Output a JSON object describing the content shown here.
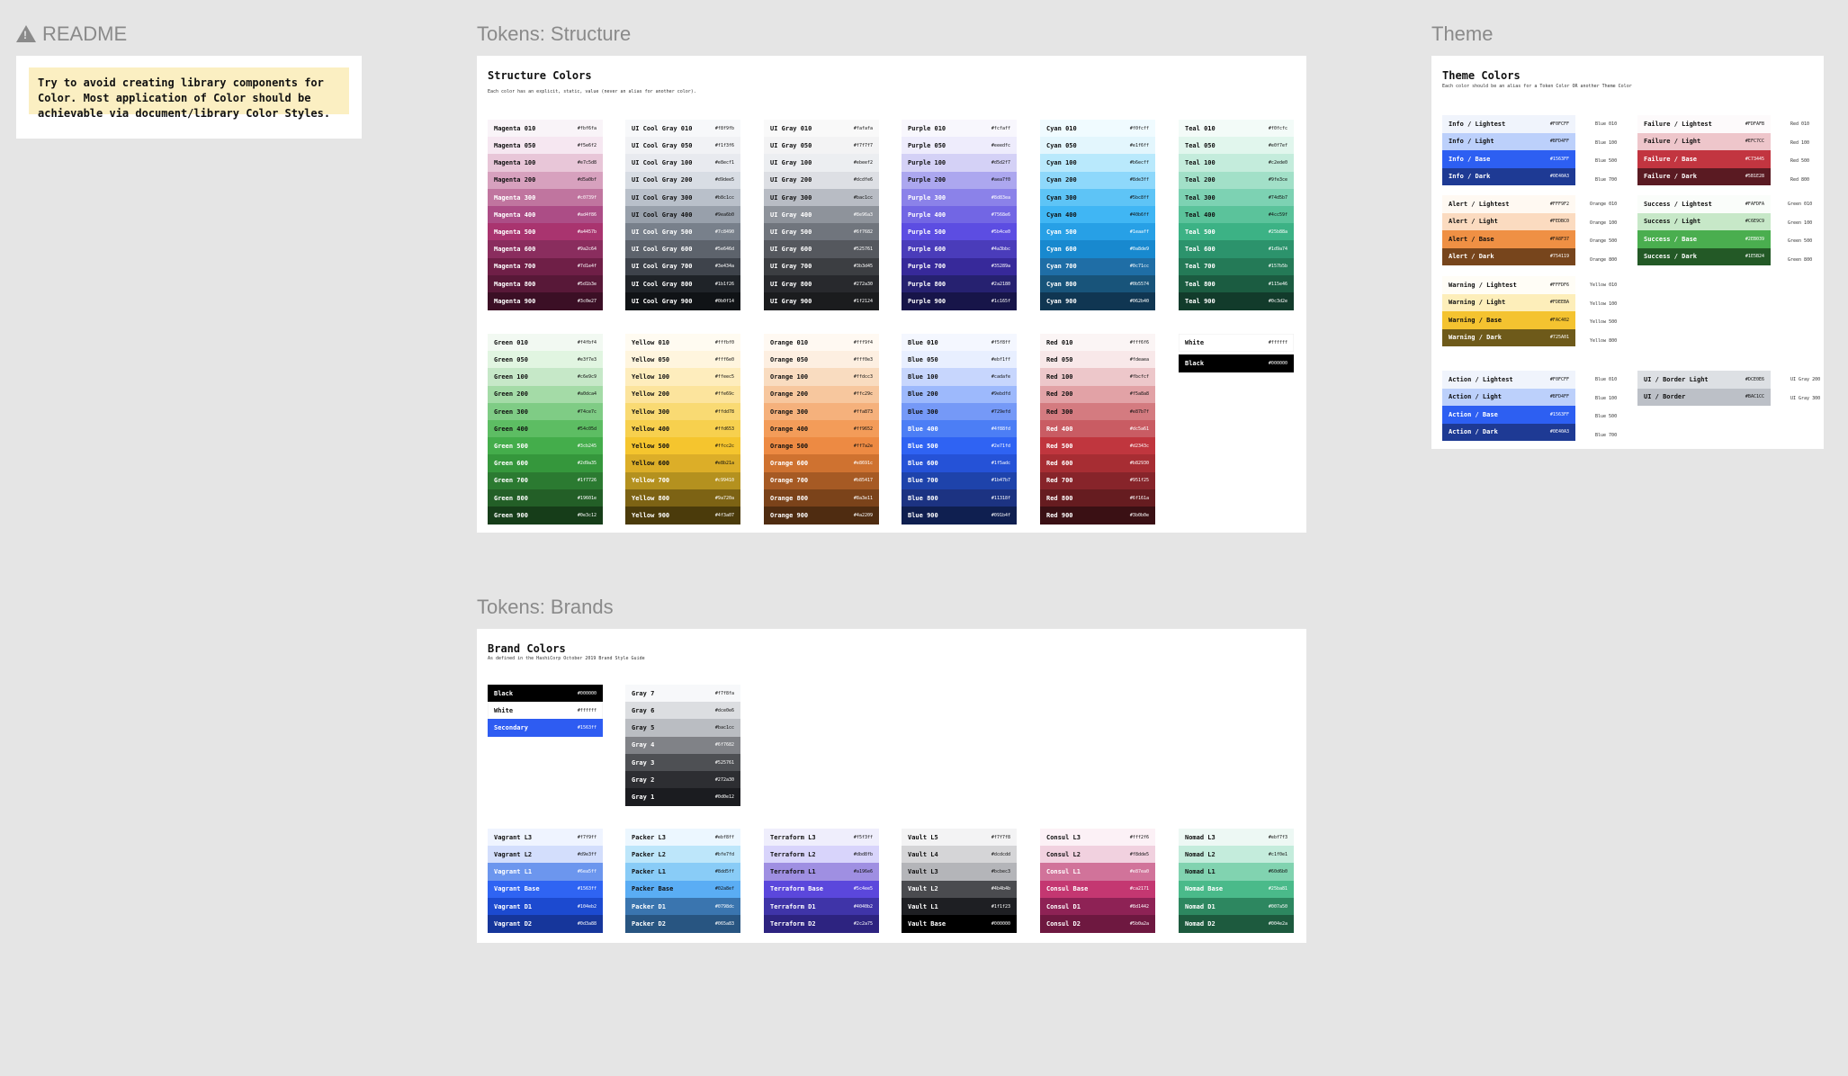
{
  "readme": {
    "title": "README",
    "note": "Try to avoid creating library components for Color. Most application of Color should be achievable via document/library Color Styles."
  },
  "structure": {
    "frame_title": "Tokens: Structure",
    "title": "Structure Colors",
    "subtitle": "Each color has an explicit, static, value (never an alias for another color).",
    "columns": [
      [
        [
          "Magenta 010",
          "#fbf6fa",
          "#f9f4f8"
        ],
        [
          "Magenta 050",
          "#f5e6f2",
          "#f6e7f1"
        ],
        [
          "Magenta 100",
          "#e7c5d8",
          "#e8c6d8"
        ],
        [
          "Magenta 200",
          "#d5a0bf",
          "#d7a1be"
        ],
        [
          "Magenta 300",
          "#c0739f",
          "#c0759f"
        ],
        [
          "Magenta 400",
          "#ad4f86",
          "#ac4d86"
        ],
        [
          "Magenta 500",
          "#a4457b",
          "#a9346f"
        ],
        [
          "Magenta 600",
          "#9a2c64",
          "#8a2d5e"
        ],
        [
          "Magenta 700",
          "#7d1e4f",
          "#6f1f47"
        ],
        [
          "Magenta 800",
          "#5d1b3e",
          "#581838"
        ],
        [
          "Magenta 900",
          "#3c0e27",
          "#3b0f25"
        ]
      ],
      [
        [
          "UI Cool Gray 010",
          "#f8f9fb",
          "#f7f8fa"
        ],
        [
          "UI Cool Gray 050",
          "#f1f3f6",
          "#f1f2f5"
        ],
        [
          "UI Cool Gray 100",
          "#e8ecf1",
          "#e8eaef"
        ],
        [
          "UI Cool Gray 200",
          "#d9dee5",
          "#d8dde4"
        ],
        [
          "UI Cool Gray 300",
          "#b8c1cc",
          "#b9c0ca"
        ],
        [
          "UI Cool Gray 400",
          "#9ea6b0",
          "#98a0ab"
        ],
        [
          "UI Cool Gray 500",
          "#7c8490",
          "#78808b"
        ],
        [
          "UI Cool Gray 600",
          "#5e646d",
          "#5d636c"
        ],
        [
          "UI Cool Gray 700",
          "#3e434a",
          "#3e434b"
        ],
        [
          "UI Cool Gray 800",
          "#1b1f26",
          "#1f2328"
        ],
        [
          "UI Cool Gray 900",
          "#0b0f14",
          "#101316"
        ]
      ],
      [
        [
          "UI Gray 010",
          "#fafafa",
          "#f9f9f9"
        ],
        [
          "UI Gray 050",
          "#f7f7f7",
          "#f3f3f4"
        ],
        [
          "UI Gray 100",
          "#ebeef2",
          "#eceef1"
        ],
        [
          "UI Gray 200",
          "#dcdfe6",
          "#dddfe4"
        ],
        [
          "UI Gray 300",
          "#bac1cc",
          "#b8bcc4"
        ],
        [
          "UI Gray 400",
          "#8e96a3",
          "#8e939b"
        ],
        [
          "UI Gray 500",
          "#6f7682",
          "#70757d"
        ],
        [
          "UI Gray 600",
          "#525761",
          "#55585e"
        ],
        [
          "UI Gray 700",
          "#3b3d45",
          "#3c3e42"
        ],
        [
          "UI Gray 800",
          "#272a30",
          "#28292d"
        ],
        [
          "UI Gray 900",
          "#1f2124",
          "#1b1c1e"
        ]
      ],
      [
        [
          "Purple 010",
          "#fcfaff",
          "#f8f7fd"
        ],
        [
          "Purple 050",
          "#eeedfc",
          "#eeecfc"
        ],
        [
          "Purple 100",
          "#d5d2f7",
          "#d4d1f6"
        ],
        [
          "Purple 200",
          "#aea7f0",
          "#aca7ef"
        ],
        [
          "Purple 300",
          "#8d83ea",
          "#8b82e9"
        ],
        [
          "Purple 400",
          "#7568e6",
          "#7266e4"
        ],
        [
          "Purple 500",
          "#5b4ce0",
          "#5c4de2"
        ],
        [
          "Purple 600",
          "#4a3bbc",
          "#4a3cba"
        ],
        [
          "Purple 700",
          "#35289a",
          "#37299a"
        ],
        [
          "Purple 800",
          "#2a2180",
          "#262170"
        ],
        [
          "Purple 900",
          "#1c165f",
          "#171549"
        ]
      ],
      [
        [
          "Cyan 010",
          "#f0fcff",
          "#f0fbff"
        ],
        [
          "Cyan 050",
          "#e1f6ff",
          "#e3f6fd"
        ],
        [
          "Cyan 100",
          "#b6ecff",
          "#b9e9fc"
        ],
        [
          "Cyan 200",
          "#8de3ff",
          "#8ed8fb"
        ],
        [
          "Cyan 300",
          "#5bc8ff",
          "#5ec4f6"
        ],
        [
          "Cyan 400",
          "#40b6ff",
          "#40b6f4"
        ],
        [
          "Cyan 500",
          "#1eaaff",
          "#27a0e6"
        ],
        [
          "Cyan 600",
          "#0a8de9",
          "#1889cf"
        ],
        [
          "Cyan 700",
          "#0c71cc",
          "#1f6ea6"
        ],
        [
          "Cyan 800",
          "#0b5574",
          "#18547a"
        ],
        [
          "Cyan 900",
          "#062b40",
          "#103652"
        ]
      ],
      [
        [
          "Teal 010",
          "#f0fcfc",
          "#f3fbf8"
        ],
        [
          "Teal 050",
          "#e0f7ef",
          "#e1f6ed"
        ],
        [
          "Teal 100",
          "#c2ede0",
          "#c4ecdc"
        ],
        [
          "Teal 200",
          "#9fe3ce",
          "#a2e0c8"
        ],
        [
          "Teal 300",
          "#74d5b7",
          "#7dd2b3"
        ],
        [
          "Teal 400",
          "#4cc59f",
          "#5bc39b"
        ],
        [
          "Teal 500",
          "#25b88a",
          "#3cb285"
        ],
        [
          "Teal 600",
          "#1d9a74",
          "#2c936c"
        ],
        [
          "Teal 700",
          "#157b5b",
          "#247a57"
        ],
        [
          "Teal 800",
          "#115e46",
          "#1b5c41"
        ],
        [
          "Teal 900",
          "#0c3d2e",
          "#123b2b"
        ]
      ],
      [
        [
          "Green 010",
          "#f4fbf4",
          "#f2f9f2"
        ],
        [
          "Green 050",
          "#e3f7e3",
          "#e1f5e1"
        ],
        [
          "Green 100",
          "#c6e9c9",
          "#c6e8c8"
        ],
        [
          "Green 200",
          "#a0dca4",
          "#a4dba7"
        ],
        [
          "Green 300",
          "#74ce7c",
          "#7fcc85"
        ],
        [
          "Green 400",
          "#54c05d",
          "#5dbd63"
        ],
        [
          "Green 500",
          "#3cb245",
          "#44ad4b"
        ],
        [
          "Green 600",
          "#2d9a35",
          "#35973c"
        ],
        [
          "Green 700",
          "#1f7726",
          "#2b7a31"
        ],
        [
          "Green 800",
          "#19601e",
          "#235f27"
        ],
        [
          "Green 900",
          "#0e3c12",
          "#163d19"
        ]
      ],
      [
        [
          "Yellow 010",
          "#fffbf0",
          "#fffbf1"
        ],
        [
          "Yellow 050",
          "#fff6e0",
          "#fff5de"
        ],
        [
          "Yellow 100",
          "#ffeec5",
          "#feedbd"
        ],
        [
          "Yellow 200",
          "#ffe69c",
          "#fce49d"
        ],
        [
          "Yellow 300",
          "#ffdd78",
          "#f9da73"
        ],
        [
          "Yellow 400",
          "#ffd653",
          "#f7d04e"
        ],
        [
          "Yellow 500",
          "#ffcc2c",
          "#f5c52e"
        ],
        [
          "Yellow 600",
          "#e8b21a",
          "#dcae28"
        ],
        [
          "Yellow 700",
          "#c99410",
          "#b4911f"
        ],
        [
          "Yellow 800",
          "#9a720a",
          "#7d6314"
        ],
        [
          "Yellow 900",
          "#4f3a07",
          "#4b3b0b"
        ]
      ],
      [
        [
          "Orange 010",
          "#fff9f4",
          "#fff9f2"
        ],
        [
          "Orange 050",
          "#fff0e3",
          "#fdefe1"
        ],
        [
          "Orange 100",
          "#ffdcc3",
          "#f9dcc0"
        ],
        [
          "Orange 200",
          "#ffc29c",
          "#f7c79e"
        ],
        [
          "Orange 300",
          "#ffa873",
          "#f5b17c"
        ],
        [
          "Orange 400",
          "#ff9652",
          "#f39c59"
        ],
        [
          "Orange 500",
          "#ff7a2e",
          "#ed8a43"
        ],
        [
          "Orange 600",
          "#e8691c",
          "#cf7230"
        ],
        [
          "Orange 700",
          "#b85417",
          "#a65a24"
        ],
        [
          "Orange 800",
          "#8a3e11",
          "#7b431a"
        ],
        [
          "Orange 900",
          "#4a2209",
          "#4f2c11"
        ]
      ],
      [
        [
          "Blue 010",
          "#f5f8ff",
          "#f4f7ff"
        ],
        [
          "Blue 050",
          "#ebf1ff",
          "#e8efff"
        ],
        [
          "Blue 100",
          "#cadafe",
          "#c7d6fd"
        ],
        [
          "Blue 200",
          "#9ebdfd",
          "#9db9fc"
        ],
        [
          "Blue 300",
          "#729efd",
          "#7599f7"
        ],
        [
          "Blue 400",
          "#4f88fd",
          "#4c7ef5"
        ],
        [
          "Blue 500",
          "#2e71fd",
          "#2f63f3"
        ],
        [
          "Blue 600",
          "#1f5adc",
          "#2552d7"
        ],
        [
          "Blue 700",
          "#1b47b7",
          "#1e43ab"
        ],
        [
          "Blue 800",
          "#11318f",
          "#1c3382"
        ],
        [
          "Blue 900",
          "#091b4f",
          "#0f1f50"
        ]
      ],
      [
        [
          "Red 010",
          "#fff6f6",
          "#fbf5f5"
        ],
        [
          "Red 050",
          "#fdeaea",
          "#f8e8e9"
        ],
        [
          "Red 100",
          "#fbcfcf",
          "#edc7ca"
        ],
        [
          "Red 200",
          "#f5a8a8",
          "#e2a2a6"
        ],
        [
          "Red 300",
          "#e87b7f",
          "#d47b80"
        ],
        [
          "Red 400",
          "#dc5a61",
          "#c95c63"
        ],
        [
          "Red 500",
          "#d2343c",
          "#c0363e"
        ],
        [
          "Red 600",
          "#b82930",
          "#a72d33"
        ],
        [
          "Red 700",
          "#951f25",
          "#87242a"
        ],
        [
          "Red 800",
          "#6f161a",
          "#661c20"
        ],
        [
          "Red 900",
          "#3b0b0e",
          "#3a1014"
        ]
      ],
      [
        [
          "White",
          "#ffffff",
          "#ffffff"
        ],
        [
          "Black",
          "#000000",
          "#000000"
        ]
      ]
    ]
  },
  "brands": {
    "frame_title": "Tokens: Brands",
    "title": "Brand Colors",
    "subtitle": "As defined in the HashiCorp October 2019 Brand Style Guide",
    "base": [
      [
        "Black",
        "#000000",
        "#000000"
      ],
      [
        "White",
        "#ffffff",
        "#ffffff"
      ],
      [
        "Secondary",
        "#1563ff",
        "#2e5cf2"
      ]
    ],
    "grays": [
      [
        "Gray 7",
        "#f7f8fa",
        "#f7f8fa"
      ],
      [
        "Gray 6",
        "#dce0e6",
        "#dcdee1"
      ],
      [
        "Gray 5",
        "#bac1cc",
        "#babdc2"
      ],
      [
        "Gray 4",
        "#6f7682",
        "#808287"
      ],
      [
        "Gray 3",
        "#525761",
        "#4e5054"
      ],
      [
        "Gray 2",
        "#272a30",
        "#2d2e32"
      ],
      [
        "Gray 1",
        "#0d0e12",
        "#1b1c20"
      ]
    ],
    "columns": [
      [
        [
          "Vagrant L3",
          "#f7f9ff",
          "#eff4ff"
        ],
        [
          "Vagrant L2",
          "#d9e3ff",
          "#d3defc"
        ],
        [
          "Vagrant L1",
          "#6ea5ff",
          "#6c96ee"
        ],
        [
          "Vagrant Base",
          "#1563ff",
          "#2f64f3"
        ],
        [
          "Vagrant D1",
          "#104eb2",
          "#1c4ad0"
        ],
        [
          "Vagrant D2",
          "#0d3a88",
          "#16369b"
        ]
      ],
      [
        [
          "Packer L3",
          "#ebf8ff",
          "#ecf7ff"
        ],
        [
          "Packer L2",
          "#bfe7fd",
          "#bde6fa"
        ],
        [
          "Packer L1",
          "#8dd5ff",
          "#89ccf7"
        ],
        [
          "Packer Base",
          "#02a8ef",
          "#5aadf4"
        ],
        [
          "Packer D1",
          "#0798dc",
          "#3a75af"
        ],
        [
          "Packer D2",
          "#065a83",
          "#285581"
        ]
      ],
      [
        [
          "Terraform L3",
          "#f5f3ff",
          "#efeefc"
        ],
        [
          "Terraform L2",
          "#dbd8fb",
          "#d8d4fb"
        ],
        [
          "Terraform L1",
          "#a196e6",
          "#9f8fe2"
        ],
        [
          "Terraform Base",
          "#5c4ee5",
          "#5b47dc"
        ],
        [
          "Terraform D1",
          "#4040b2",
          "#3f34a8"
        ],
        [
          "Terraform D2",
          "#2c2a75",
          "#2d2380"
        ]
      ],
      [
        [
          "Vault L5",
          "#f7f7f8",
          "#f3f3f4"
        ],
        [
          "Vault L4",
          "#dcdcdd",
          "#d5d5d7"
        ],
        [
          "Vault L3",
          "#bcbec3",
          "#b4b5b9"
        ],
        [
          "Vault L2",
          "#4b4b4b",
          "#4a4b4f"
        ],
        [
          "Vault L1",
          "#1f1f23",
          "#1e1f23"
        ],
        [
          "Vault Base",
          "#000000",
          "#000000"
        ]
      ],
      [
        [
          "Consul L3",
          "#fff2f6",
          "#fcf1f6"
        ],
        [
          "Consul L2",
          "#f8dde5",
          "#f1d1df"
        ],
        [
          "Consul L1",
          "#e87ea0",
          "#d1739a"
        ],
        [
          "Consul Base",
          "#ca2171",
          "#c43771"
        ],
        [
          "Consul D1",
          "#8d1442",
          "#8e2255"
        ],
        [
          "Consul D2",
          "#5b0a2a",
          "#6e1840"
        ]
      ],
      [
        [
          "Nomad L3",
          "#ebf7f3",
          "#edf8f4"
        ],
        [
          "Nomad L2",
          "#c1f0e1",
          "#c4ecdc"
        ],
        [
          "Nomad L1",
          "#60d6b0",
          "#81d3b0"
        ],
        [
          "Nomad Base",
          "#25ba81",
          "#4aba8a"
        ],
        [
          "Nomad D1",
          "#007a50",
          "#2d8760"
        ],
        [
          "Nomad D2",
          "#004e2a",
          "#1d5a3e"
        ]
      ]
    ]
  },
  "theme": {
    "frame_title": "Theme",
    "title": "Theme Colors",
    "subtitle": "Each color should be an alias for a Token Color OR another Theme Color",
    "groups": [
      [
        [
          "Info / Lightest",
          "#F0FCFF",
          "#f0f4fc",
          "Blue 010"
        ],
        [
          "Info / Light",
          "#BFD4FF",
          "#bcd0fb",
          "Blue 100"
        ],
        [
          "Info / Base",
          "#1563FF",
          "#2d5ff2",
          "Blue 500"
        ],
        [
          "Info / Dark",
          "#0E40A3",
          "#1e3a94",
          "Blue 700"
        ]
      ],
      [
        [
          "Alert / Lightest",
          "#FFF9F2",
          "#fff9f2",
          "Orange 010"
        ],
        [
          "Alert / Light",
          "#FEDBC0",
          "#fbdbc0",
          "Orange 100"
        ],
        [
          "Alert / Base",
          "#FA8F37",
          "#ef9044",
          "Orange 500"
        ],
        [
          "Alert / Dark",
          "#754119",
          "#77451c",
          "Orange 800"
        ]
      ],
      [
        [
          "Warning / Lightest",
          "#FFFDF6",
          "#fffdf6",
          "Yellow 010"
        ],
        [
          "Warning / Light",
          "#FDEEBA",
          "#fdeeba",
          "Yellow 100"
        ],
        [
          "Warning / Base",
          "#FAC402",
          "#f4c330",
          "Yellow 500"
        ],
        [
          "Warning / Dark",
          "#725A01",
          "#6e5a1a",
          "Yellow 800"
        ]
      ],
      [
        [
          "Action / Lightest",
          "#F0FCFF",
          "#f0f4fc",
          "Blue 010"
        ],
        [
          "Action / Light",
          "#BFD4FF",
          "#bcd0fb",
          "Blue 100"
        ],
        [
          "Action / Base",
          "#1563FF",
          "#2d5ff2",
          "Blue 500"
        ],
        [
          "Action / Dark",
          "#0E40A3",
          "#1e3a94",
          "Blue 700"
        ]
      ],
      [
        [
          "Failure / Lightest",
          "#FDFAFB",
          "#fdfafb",
          "Red 010"
        ],
        [
          "Failure / Light",
          "#EFC7CC",
          "#eec6cb",
          "Red 100"
        ],
        [
          "Failure / Base",
          "#C73445",
          "#c23540",
          "Red 500"
        ],
        [
          "Failure / Dark",
          "#5B1E28",
          "#5a1a22",
          "Red 800"
        ]
      ],
      [
        [
          "Success / Lightest",
          "#FAFDFA",
          "#fafdfa",
          "Green 010"
        ],
        [
          "Success / Light",
          "#C6E9C9",
          "#c7e8c8",
          "Green 100"
        ],
        [
          "Success / Base",
          "#2EB039",
          "#4aae4f",
          "Green 500"
        ],
        [
          "Success / Dark",
          "#1E5B24",
          "#235926",
          "Green 800"
        ]
      ],
      [
        [
          "UI / Border Light",
          "#DCE0E6",
          "#dde0e4",
          "UI Gray 200"
        ],
        [
          "UI / Border",
          "#BAC1CC",
          "#bcc0c7",
          "UI Gray 300"
        ]
      ]
    ]
  }
}
